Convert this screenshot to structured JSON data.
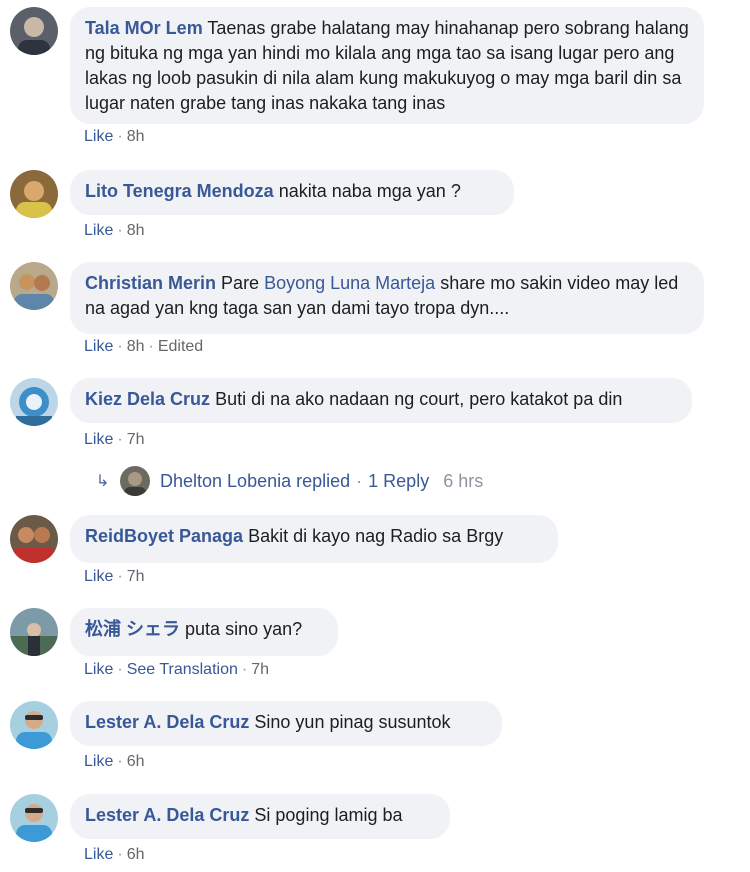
{
  "comments": [
    {
      "author": "Tala MOr Lem",
      "text": "Taenas grabe halatang may hinahanap pero sobrang halang ng bituka ng mga yan hindi mo kilala ang mga tao sa isang lugar pero ang lakas ng loob pasukin di nila alam kung makukuyog o may mga baril din sa lugar naten grabe tang inas nakaka tang inas",
      "like": "Like",
      "time": "8h"
    },
    {
      "author": "Lito Tenegra Mendoza",
      "text": "nakita naba mga yan ?",
      "like": "Like",
      "time": "8h"
    },
    {
      "author": "Christian Merin",
      "text_before": "Pare ",
      "mention": "Boyong Luna Marteja",
      "text_after": " share mo sakin video may led na agad yan kng taga san yan dami tayo tropa dyn....",
      "like": "Like",
      "time": "8h",
      "edited": "Edited"
    },
    {
      "author": "Kiez Dela Cruz",
      "text": "Buti di na ako nadaan ng court, pero katakot pa din",
      "like": "Like",
      "time": "7h",
      "replies": {
        "label": "Dhelton Lobenia replied",
        "count": "1 Reply",
        "time": "6 hrs"
      }
    },
    {
      "author": "ReidBoyet Panaga",
      "text": "Bakit di kayo nag Radio sa Brgy",
      "like": "Like",
      "time": "7h"
    },
    {
      "author": "松浦 シェラ",
      "text": "puta sino yan?",
      "like": "Like",
      "translate": "See Translation",
      "time": "7h"
    },
    {
      "author": "Lester A. Dela Cruz",
      "text": "Sino yun pinag susuntok",
      "like": "Like",
      "time": "6h"
    },
    {
      "author": "Lester A. Dela Cruz",
      "text": "Si poging lamig ba",
      "like": "Like",
      "time": "6h"
    }
  ]
}
